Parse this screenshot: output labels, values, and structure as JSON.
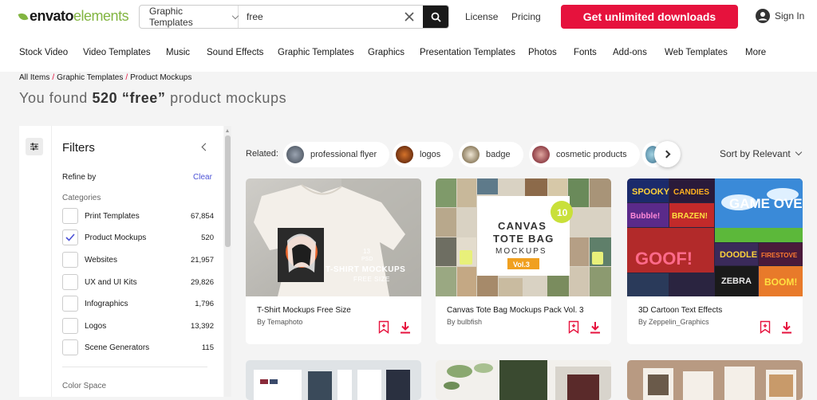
{
  "header": {
    "logo_bold": "envato",
    "logo_light": "elements",
    "search_category": "Graphic Templates",
    "search_value": "free",
    "license": "License",
    "pricing": "Pricing",
    "cta": "Get unlimited downloads",
    "signin": "Sign In"
  },
  "nav": [
    "Stock Video",
    "Video Templates",
    "Music",
    "Sound Effects",
    "Graphic Templates",
    "Graphics",
    "Presentation Templates",
    "Photos",
    "Fonts",
    "Add-ons",
    "Web Templates",
    "More"
  ],
  "breadcrumb": [
    "All Items",
    "Graphic Templates",
    "Product Mockups"
  ],
  "results": {
    "prefix": "You found",
    "count": "520",
    "query": "“free”",
    "suffix": "product mockups"
  },
  "filters": {
    "title": "Filters",
    "refine_by": "Refine by",
    "clear": "Clear",
    "categories_label": "Categories",
    "categories": [
      {
        "label": "Print Templates",
        "count": "67,854",
        "checked": false
      },
      {
        "label": "Product Mockups",
        "count": "520",
        "checked": true
      },
      {
        "label": "Websites",
        "count": "21,957",
        "checked": false
      },
      {
        "label": "UX and UI Kits",
        "count": "29,826",
        "checked": false
      },
      {
        "label": "Infographics",
        "count": "1,796",
        "checked": false
      },
      {
        "label": "Logos",
        "count": "13,392",
        "checked": false
      },
      {
        "label": "Scene Generators",
        "count": "115",
        "checked": false
      }
    ],
    "color_space": "Color Space"
  },
  "related": {
    "label": "Related:",
    "chips": [
      "professional flyer",
      "logos",
      "badge",
      "cosmetic products"
    ]
  },
  "sort": "Sort by Relevant",
  "cards": [
    {
      "title": "T-Shirt Mockups Free Size",
      "author_prefix": "By",
      "author": "Temaphoto",
      "img_count": "13",
      "img_format": "PSD",
      "img_title": "T-SHIRT MOCKUPS",
      "img_sub": "FREE SIZE"
    },
    {
      "title": "Canvas Tote Bag Mockups Pack Vol. 3",
      "author_prefix": "By",
      "author": "bulbfish",
      "img_line1": "CANVAS",
      "img_line2": "TOTE BAG",
      "img_line3": "MOCKUPS",
      "img_badge": "10",
      "img_vol": "Vol.3"
    },
    {
      "title": "3D Cartoon Text Effects",
      "author_prefix": "By",
      "author": "Zeppelin_Graphics",
      "img_words": [
        "SPOOKY",
        "CANDIES",
        "Bubble!",
        "BRAZEN!",
        "GAME OVER",
        "GOOF!",
        "DOODLE",
        "FIRESTOVE",
        "ZEBRA",
        "BOOM!"
      ]
    }
  ],
  "colors": {
    "accent": "#e6123d",
    "brand_green": "#82b541",
    "link_blue": "#4c52d6"
  }
}
